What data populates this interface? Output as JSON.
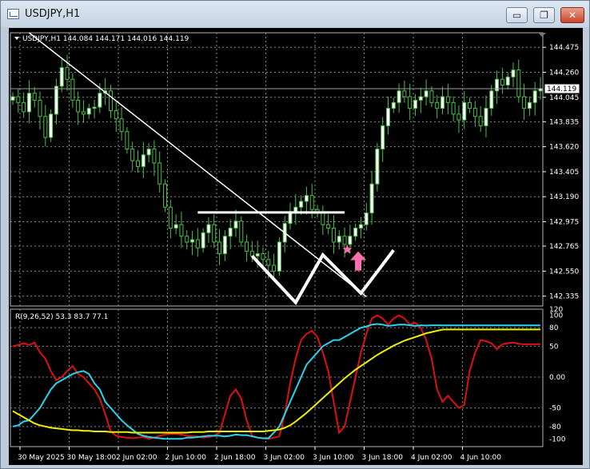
{
  "window": {
    "title": "USDJPY,H1",
    "buttons": {
      "minimize": "▭",
      "maximize": "❐",
      "close": "✕"
    }
  },
  "chart_data": [
    {
      "type": "candlestick",
      "symbol_header": "USDJPY,H1",
      "ohlc_header": "144.084 144.171 144.016 144.119",
      "current_price_label": "144.119",
      "current_price": 144.119,
      "ylim": [
        142.25,
        144.6
      ],
      "y_ticks": [
        "144.475",
        "144.260",
        "144.045",
        "143.835",
        "143.620",
        "143.405",
        "143.190",
        "142.975",
        "142.765",
        "142.550",
        "142.335"
      ],
      "x_ticks": [
        "30 May 2025",
        "30 May 18:00",
        "2 Jun 02:00",
        "2 Jun 10:00",
        "2 Jun 18:00",
        "3 Jun 02:00",
        "3 Jun 10:00",
        "3 Jun 18:00",
        "4 Jun 02:00",
        "4 Jun 10:00"
      ],
      "bar_count": 98,
      "closes": [
        144.05,
        144.0,
        143.92,
        144.08,
        144.02,
        143.88,
        143.7,
        143.9,
        144.14,
        144.3,
        144.2,
        144.02,
        143.92,
        143.9,
        143.95,
        143.96,
        144.08,
        144.1,
        143.93,
        143.86,
        143.75,
        143.6,
        143.5,
        143.45,
        143.55,
        143.6,
        143.48,
        143.3,
        143.1,
        142.92,
        142.95,
        142.85,
        142.8,
        142.82,
        142.75,
        142.88,
        142.95,
        142.8,
        142.7,
        142.85,
        142.92,
        142.98,
        142.8,
        142.72,
        142.68,
        142.7,
        142.65,
        142.6,
        142.55,
        142.8,
        142.96,
        143.05,
        143.1,
        143.15,
        143.2,
        143.08,
        143.05,
        142.95,
        142.92,
        142.8,
        142.85,
        142.78,
        142.85,
        142.92,
        142.95,
        143.05,
        143.3,
        143.6,
        143.8,
        143.95,
        144.0,
        144.1,
        144.05,
        143.95,
        144.02,
        144.05,
        144.1,
        144.0,
        143.95,
        144.05,
        144.0,
        143.9,
        143.85,
        144.0,
        143.95,
        143.88,
        143.8,
        143.95,
        144.1,
        144.2,
        144.15,
        144.22,
        144.28,
        144.05,
        143.95,
        144.0,
        144.1,
        144.119
      ],
      "annotations": [
        "trend line",
        "horizontal line",
        "W pattern",
        "star marker",
        "buy arrow"
      ]
    },
    {
      "type": "line",
      "indicator_label": "R(9,26,52) 53.3 83.7 77.1",
      "ylim": [
        -110,
        110
      ],
      "y_ticks": [
        "120",
        "100",
        "80",
        "50",
        "0.00",
        "-50",
        "-80",
        "-100"
      ],
      "series": [
        {
          "color": "#e01010",
          "values": [
            50,
            52,
            55,
            52,
            56,
            40,
            30,
            10,
            -5,
            0,
            10,
            18,
            5,
            0,
            -10,
            -20,
            -35,
            -60,
            -88,
            -95,
            -97,
            -98,
            -99,
            -98,
            -97,
            -100,
            -98,
            -95,
            -93,
            -92,
            -92,
            -93,
            -95,
            -96,
            -96,
            -98,
            -97,
            -95,
            -90,
            -60,
            -30,
            -20,
            -35,
            -70,
            -95,
            -98,
            -99,
            -100,
            -98,
            -96,
            -60,
            -10,
            30,
            60,
            70,
            75,
            65,
            40,
            10,
            -40,
            -90,
            -80,
            -40,
            0,
            40,
            70,
            95,
            100,
            95,
            85,
            95,
            100,
            95,
            85,
            88,
            80,
            60,
            30,
            -20,
            -40,
            -30,
            -40,
            -50,
            -45,
            10,
            40,
            60,
            58,
            55,
            45,
            53.3,
            55,
            56,
            54,
            53,
            53.5,
            53.2,
            53.3
          ]
        },
        {
          "color": "#2ad4ee",
          "values": [
            -80,
            -78,
            -72,
            -70,
            -60,
            -50,
            -35,
            -20,
            -10,
            -5,
            0,
            5,
            8,
            10,
            5,
            -10,
            -20,
            -40,
            -50,
            -60,
            -70,
            -78,
            -85,
            -92,
            -95,
            -97,
            -98,
            -99,
            -100,
            -100,
            -100,
            -100,
            -98,
            -98,
            -97,
            -96,
            -95,
            -95,
            -95,
            -96,
            -95,
            -93,
            -94,
            -94,
            -96,
            -98,
            -99,
            -99,
            -90,
            -80,
            -60,
            -40,
            -20,
            0,
            20,
            30,
            40,
            50,
            55,
            60,
            60,
            65,
            70,
            75,
            80,
            82,
            85,
            86,
            85,
            83,
            84,
            85,
            85,
            84,
            83,
            84,
            83.5,
            84,
            84,
            83.8,
            83.7,
            83.7,
            83.7,
            83.7,
            83.7,
            83.7,
            83.7,
            83.7,
            83.7,
            83.7,
            83.7,
            83.7,
            83.7,
            83.7,
            83.7,
            83.7,
            83.7,
            83.7
          ]
        },
        {
          "color": "#f0f000",
          "values": [
            -55,
            -60,
            -65,
            -70,
            -75,
            -78,
            -80,
            -82,
            -83,
            -84,
            -85,
            -86,
            -86,
            -87,
            -87,
            -88,
            -88,
            -88,
            -89,
            -89,
            -89,
            -89,
            -90,
            -90,
            -90,
            -90,
            -90,
            -90,
            -90,
            -90,
            -90,
            -90,
            -90,
            -89,
            -89,
            -89,
            -88,
            -88,
            -88,
            -88,
            -88,
            -88,
            -88,
            -88,
            -88,
            -88,
            -88,
            -87,
            -86,
            -85,
            -82,
            -78,
            -72,
            -65,
            -58,
            -50,
            -42,
            -34,
            -26,
            -18,
            -10,
            -2,
            5,
            12,
            18,
            24,
            30,
            36,
            41,
            46,
            51,
            55,
            59,
            62,
            65,
            68,
            71,
            73,
            75,
            77,
            77.1,
            77.1,
            77.1,
            77.1,
            77.1,
            77.1,
            77.1,
            77.1,
            77.1,
            77.1,
            77.1,
            77.1,
            77.1,
            77.1,
            77.1,
            77.1,
            77.1,
            77.1
          ]
        }
      ]
    }
  ]
}
